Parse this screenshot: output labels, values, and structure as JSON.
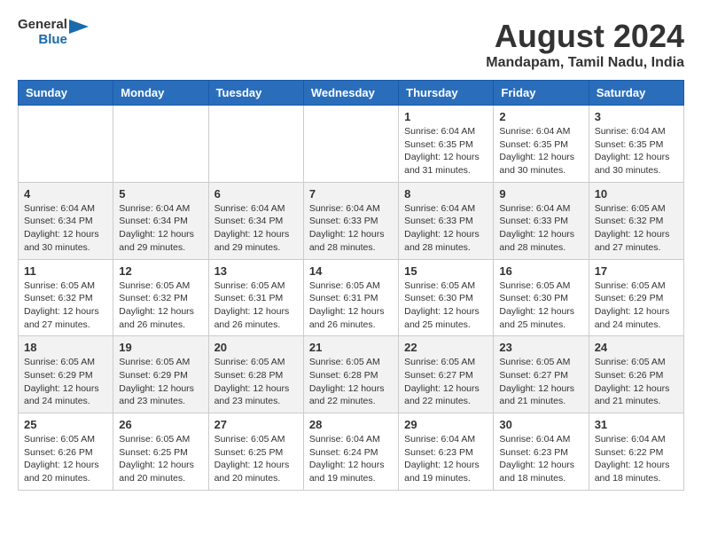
{
  "header": {
    "logo_general": "General",
    "logo_blue": "Blue",
    "main_title": "August 2024",
    "subtitle": "Mandapam, Tamil Nadu, India"
  },
  "calendar": {
    "days_of_week": [
      "Sunday",
      "Monday",
      "Tuesday",
      "Wednesday",
      "Thursday",
      "Friday",
      "Saturday"
    ],
    "weeks": [
      [
        {
          "day": "",
          "info": ""
        },
        {
          "day": "",
          "info": ""
        },
        {
          "day": "",
          "info": ""
        },
        {
          "day": "",
          "info": ""
        },
        {
          "day": "1",
          "info": "Sunrise: 6:04 AM\nSunset: 6:35 PM\nDaylight: 12 hours\nand 31 minutes."
        },
        {
          "day": "2",
          "info": "Sunrise: 6:04 AM\nSunset: 6:35 PM\nDaylight: 12 hours\nand 30 minutes."
        },
        {
          "day": "3",
          "info": "Sunrise: 6:04 AM\nSunset: 6:35 PM\nDaylight: 12 hours\nand 30 minutes."
        }
      ],
      [
        {
          "day": "4",
          "info": "Sunrise: 6:04 AM\nSunset: 6:34 PM\nDaylight: 12 hours\nand 30 minutes."
        },
        {
          "day": "5",
          "info": "Sunrise: 6:04 AM\nSunset: 6:34 PM\nDaylight: 12 hours\nand 29 minutes."
        },
        {
          "day": "6",
          "info": "Sunrise: 6:04 AM\nSunset: 6:34 PM\nDaylight: 12 hours\nand 29 minutes."
        },
        {
          "day": "7",
          "info": "Sunrise: 6:04 AM\nSunset: 6:33 PM\nDaylight: 12 hours\nand 28 minutes."
        },
        {
          "day": "8",
          "info": "Sunrise: 6:04 AM\nSunset: 6:33 PM\nDaylight: 12 hours\nand 28 minutes."
        },
        {
          "day": "9",
          "info": "Sunrise: 6:04 AM\nSunset: 6:33 PM\nDaylight: 12 hours\nand 28 minutes."
        },
        {
          "day": "10",
          "info": "Sunrise: 6:05 AM\nSunset: 6:32 PM\nDaylight: 12 hours\nand 27 minutes."
        }
      ],
      [
        {
          "day": "11",
          "info": "Sunrise: 6:05 AM\nSunset: 6:32 PM\nDaylight: 12 hours\nand 27 minutes."
        },
        {
          "day": "12",
          "info": "Sunrise: 6:05 AM\nSunset: 6:32 PM\nDaylight: 12 hours\nand 26 minutes."
        },
        {
          "day": "13",
          "info": "Sunrise: 6:05 AM\nSunset: 6:31 PM\nDaylight: 12 hours\nand 26 minutes."
        },
        {
          "day": "14",
          "info": "Sunrise: 6:05 AM\nSunset: 6:31 PM\nDaylight: 12 hours\nand 26 minutes."
        },
        {
          "day": "15",
          "info": "Sunrise: 6:05 AM\nSunset: 6:30 PM\nDaylight: 12 hours\nand 25 minutes."
        },
        {
          "day": "16",
          "info": "Sunrise: 6:05 AM\nSunset: 6:30 PM\nDaylight: 12 hours\nand 25 minutes."
        },
        {
          "day": "17",
          "info": "Sunrise: 6:05 AM\nSunset: 6:29 PM\nDaylight: 12 hours\nand 24 minutes."
        }
      ],
      [
        {
          "day": "18",
          "info": "Sunrise: 6:05 AM\nSunset: 6:29 PM\nDaylight: 12 hours\nand 24 minutes."
        },
        {
          "day": "19",
          "info": "Sunrise: 6:05 AM\nSunset: 6:29 PM\nDaylight: 12 hours\nand 23 minutes."
        },
        {
          "day": "20",
          "info": "Sunrise: 6:05 AM\nSunset: 6:28 PM\nDaylight: 12 hours\nand 23 minutes."
        },
        {
          "day": "21",
          "info": "Sunrise: 6:05 AM\nSunset: 6:28 PM\nDaylight: 12 hours\nand 22 minutes."
        },
        {
          "day": "22",
          "info": "Sunrise: 6:05 AM\nSunset: 6:27 PM\nDaylight: 12 hours\nand 22 minutes."
        },
        {
          "day": "23",
          "info": "Sunrise: 6:05 AM\nSunset: 6:27 PM\nDaylight: 12 hours\nand 21 minutes."
        },
        {
          "day": "24",
          "info": "Sunrise: 6:05 AM\nSunset: 6:26 PM\nDaylight: 12 hours\nand 21 minutes."
        }
      ],
      [
        {
          "day": "25",
          "info": "Sunrise: 6:05 AM\nSunset: 6:26 PM\nDaylight: 12 hours\nand 20 minutes."
        },
        {
          "day": "26",
          "info": "Sunrise: 6:05 AM\nSunset: 6:25 PM\nDaylight: 12 hours\nand 20 minutes."
        },
        {
          "day": "27",
          "info": "Sunrise: 6:05 AM\nSunset: 6:25 PM\nDaylight: 12 hours\nand 20 minutes."
        },
        {
          "day": "28",
          "info": "Sunrise: 6:04 AM\nSunset: 6:24 PM\nDaylight: 12 hours\nand 19 minutes."
        },
        {
          "day": "29",
          "info": "Sunrise: 6:04 AM\nSunset: 6:23 PM\nDaylight: 12 hours\nand 19 minutes."
        },
        {
          "day": "30",
          "info": "Sunrise: 6:04 AM\nSunset: 6:23 PM\nDaylight: 12 hours\nand 18 minutes."
        },
        {
          "day": "31",
          "info": "Sunrise: 6:04 AM\nSunset: 6:22 PM\nDaylight: 12 hours\nand 18 minutes."
        }
      ]
    ]
  }
}
